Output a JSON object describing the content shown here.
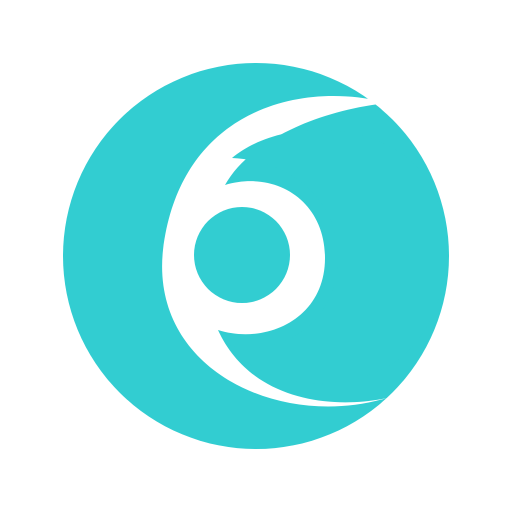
{
  "logo": {
    "name": "app-logo-icon",
    "colors": {
      "primary": "#32CDD1",
      "background": "#FFFFFF"
    }
  }
}
